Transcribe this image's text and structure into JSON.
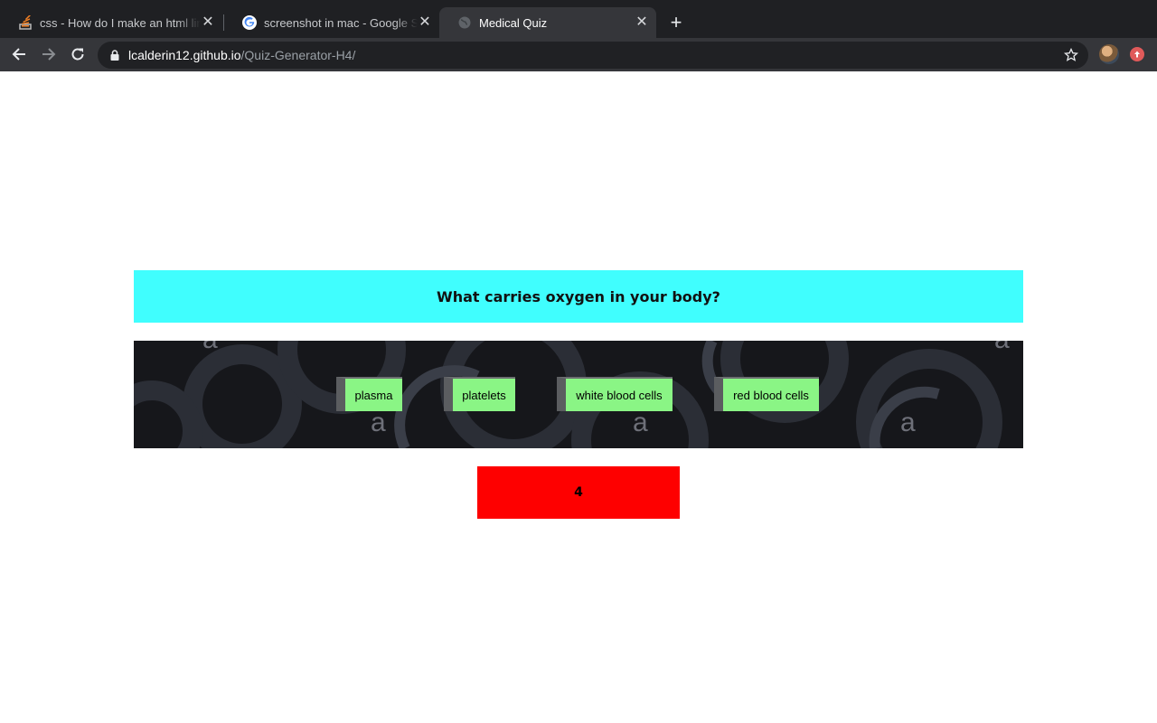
{
  "browser": {
    "tabs": [
      {
        "title": "css - How do I make an html link",
        "favicon": "stackoverflow-icon",
        "active": false
      },
      {
        "title": "screenshot in mac - Google Search",
        "favicon": "google-icon",
        "active": false
      },
      {
        "title": "Medical Quiz",
        "favicon": "globe-icon",
        "active": true
      }
    ],
    "url_host": "lcalderin12.github.io",
    "url_path": "/Quiz-Generator-H4/"
  },
  "quiz": {
    "question": "What carries oxygen in your body?",
    "answers": [
      {
        "label": "plasma"
      },
      {
        "label": "platelets"
      },
      {
        "label": "white blood cells"
      },
      {
        "label": "red blood cells"
      }
    ],
    "counter": "4"
  },
  "colors": {
    "question_bg": "#40fefe",
    "answer_bg": "#8af585",
    "counter_bg": "#fe0000",
    "panel_bg": "#16171b"
  }
}
